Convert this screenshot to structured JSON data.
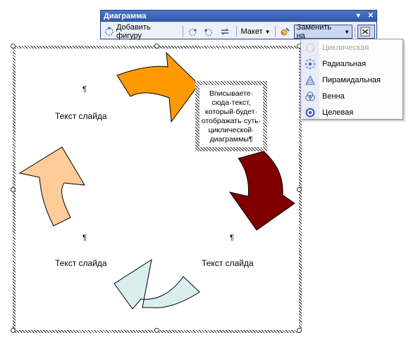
{
  "toolbar": {
    "title": "Диаграмма",
    "add_shape_label": "Добавить фигуру",
    "layout_label": "Макет",
    "change_to_label": "Заменить на",
    "controls": [
      "▾",
      "✕"
    ]
  },
  "menu": {
    "items": [
      {
        "label": "Циклическая",
        "icon": "cycle-diagram-icon",
        "enabled": false
      },
      {
        "label": "Радиальная",
        "icon": "radial-diagram-icon",
        "enabled": true
      },
      {
        "label": "Пирамидальная",
        "icon": "pyramid-diagram-icon",
        "enabled": true
      },
      {
        "label": "Венна",
        "icon": "venn-diagram-icon",
        "enabled": true
      },
      {
        "label": "Целевая",
        "icon": "target-diagram-icon",
        "enabled": true
      }
    ]
  },
  "diagram": {
    "slide_texts": [
      "Текст слайда",
      "Текст слайда",
      "Текст слайда"
    ],
    "pilcrow": "¶",
    "textbox_lines": [
      "Вписываете·",
      "сюда·текст,",
      "который·будет·",
      "отображать·суть·",
      "циклической·",
      "диаграммы¶"
    ],
    "arrow_colors": {
      "orange": "#ff9900",
      "maroon": "#800000",
      "lightblue": "#daeef0",
      "peach": "#ffcc99"
    }
  }
}
